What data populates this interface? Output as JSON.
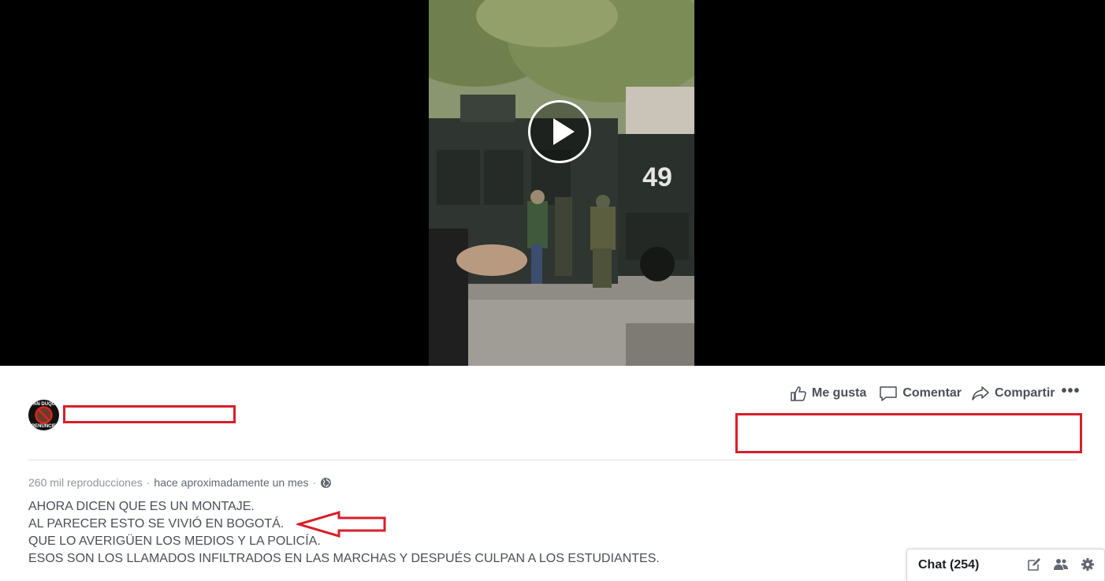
{
  "video": {
    "vehicle_number": "49",
    "play_icon": "play-icon"
  },
  "actions": {
    "like": "Me gusta",
    "comment": "Comentar",
    "share": "Compartir",
    "more": "•••"
  },
  "page": {
    "avatar_top_text": "IVAN DUQUE",
    "avatar_bottom_text": "RENUNCIE"
  },
  "meta": {
    "views": "260 mil reproducciones",
    "separator": "·",
    "time": "hace aproximadamente un mes",
    "separator2": "·",
    "privacy_icon": "globe-icon"
  },
  "caption": {
    "lines": [
      "AHORA DICEN QUE ES UN MONTAJE.",
      "AL PARECER ESTO SE VIVIÓ EN BOGOTÁ.",
      "QUE LO AVERIGÜEN LOS MEDIOS Y LA POLICÍA.",
      "ESOS SON LOS LLAMADOS INFILTRADOS EN LAS MARCHAS Y DESPUÉS CULPAN A LOS ESTUDIANTES."
    ]
  },
  "chat": {
    "label": "Chat (254)"
  },
  "colors": {
    "annotation_red": "#d71f2a",
    "text_gray": "#4b4f56",
    "meta_gray": "#90949c"
  }
}
